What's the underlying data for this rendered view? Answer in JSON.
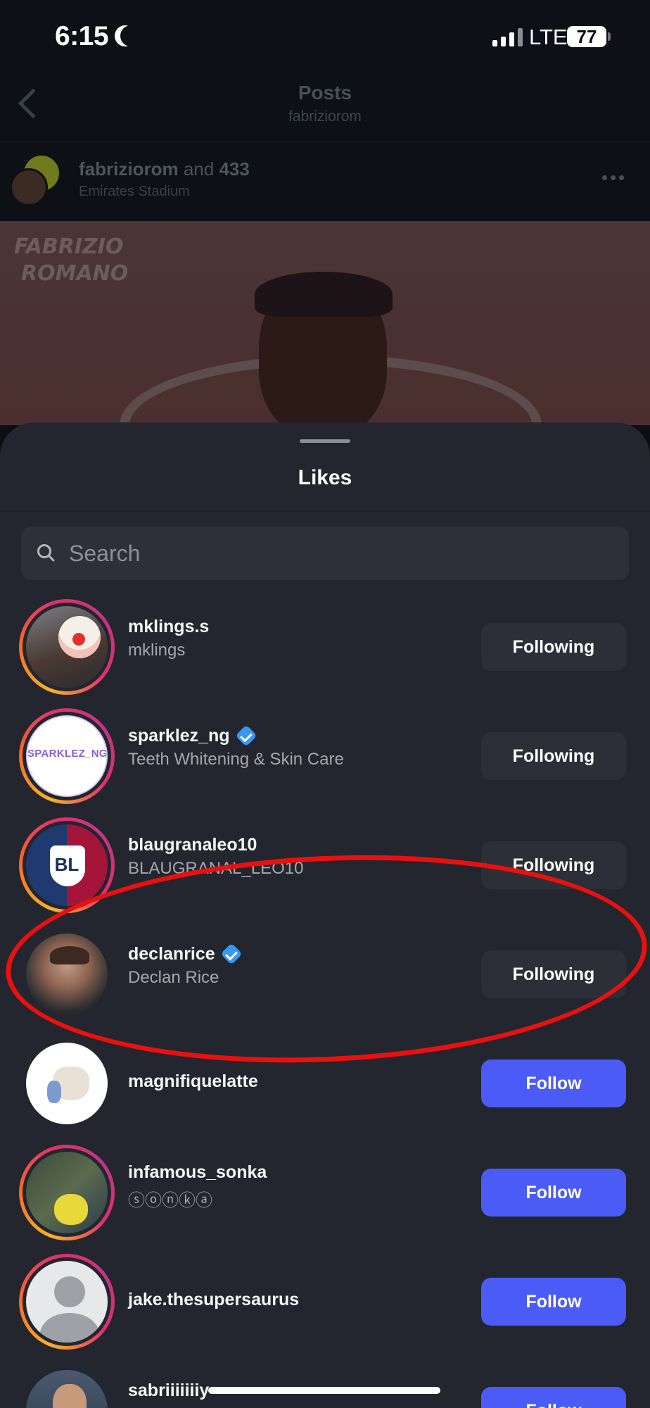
{
  "status_bar": {
    "time": "6:15",
    "network": "LTE",
    "battery": "77"
  },
  "background_post": {
    "nav_title": "Posts",
    "nav_subtitle": "fabriziorom",
    "author_primary": "fabriziorom",
    "author_joiner": "and",
    "author_secondary": "433",
    "location": "Emirates Stadium",
    "watermark_line1": "FABRIZIO",
    "watermark_line2": "ROMANO"
  },
  "sheet": {
    "title": "Likes",
    "search_placeholder": "Search",
    "users": [
      {
        "username": "mklings.s",
        "full_name": "mklings",
        "verified": false,
        "button": "Following"
      },
      {
        "username": "sparklez_ng",
        "full_name": "Teeth Whitening & Skin Care",
        "verified": true,
        "button": "Following",
        "avatar_text": "SPARKLEZ_NG"
      },
      {
        "username": "blaugranaleo10",
        "full_name": "BLAUGRANAL_LEO10",
        "verified": false,
        "button": "Following",
        "avatar_text": "BL"
      },
      {
        "username": "declanrice",
        "full_name": "Declan Rice",
        "verified": true,
        "button": "Following"
      },
      {
        "username": "magnifiquelatte",
        "full_name": "",
        "verified": false,
        "button": "Follow"
      },
      {
        "username": "infamous_sonka",
        "full_name": "ⓢⓞⓝⓚⓐ",
        "verified": false,
        "button": "Follow"
      },
      {
        "username": "jake.thesupersaurus",
        "full_name": "",
        "verified": false,
        "button": "Follow"
      },
      {
        "username": "sabriiiiiiiy",
        "full_name": "",
        "verified": false,
        "button": "Follow"
      }
    ]
  },
  "colors": {
    "sheet_background": "#23262e",
    "follow_button": "#4a5cf5",
    "following_button": "#2c2f37",
    "verified_badge": "#3897f0",
    "annotation": "#e8110f"
  }
}
